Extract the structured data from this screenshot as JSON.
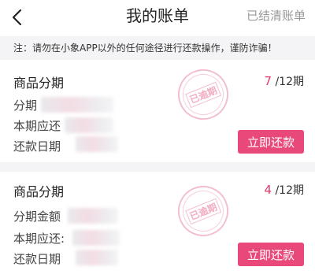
{
  "navbar": {
    "back_icon": "chevron-left-icon",
    "title": "我的账单",
    "right_label": "已结清账单"
  },
  "notice": {
    "text": "注：请勿在小象APP以外的任何途径进行还款操作，谨防诈骗！"
  },
  "bills": [
    {
      "product": "商品分期",
      "current_period": "7",
      "total_period": "/12期",
      "fields": [
        "分期",
        "本期应还",
        "还款日期"
      ],
      "stamp": "已逾期",
      "button": "立即还款"
    },
    {
      "product": "商品分期",
      "current_period": "4",
      "total_period": "/12期",
      "fields": [
        "分期金额",
        "本期应还:",
        "还款日期"
      ],
      "stamp": "已逾期",
      "button": "立即还款"
    }
  ],
  "colors": {
    "accent": "#e8497a",
    "period_current": "#e23b6b",
    "background_gap": "#f4f4f6"
  }
}
